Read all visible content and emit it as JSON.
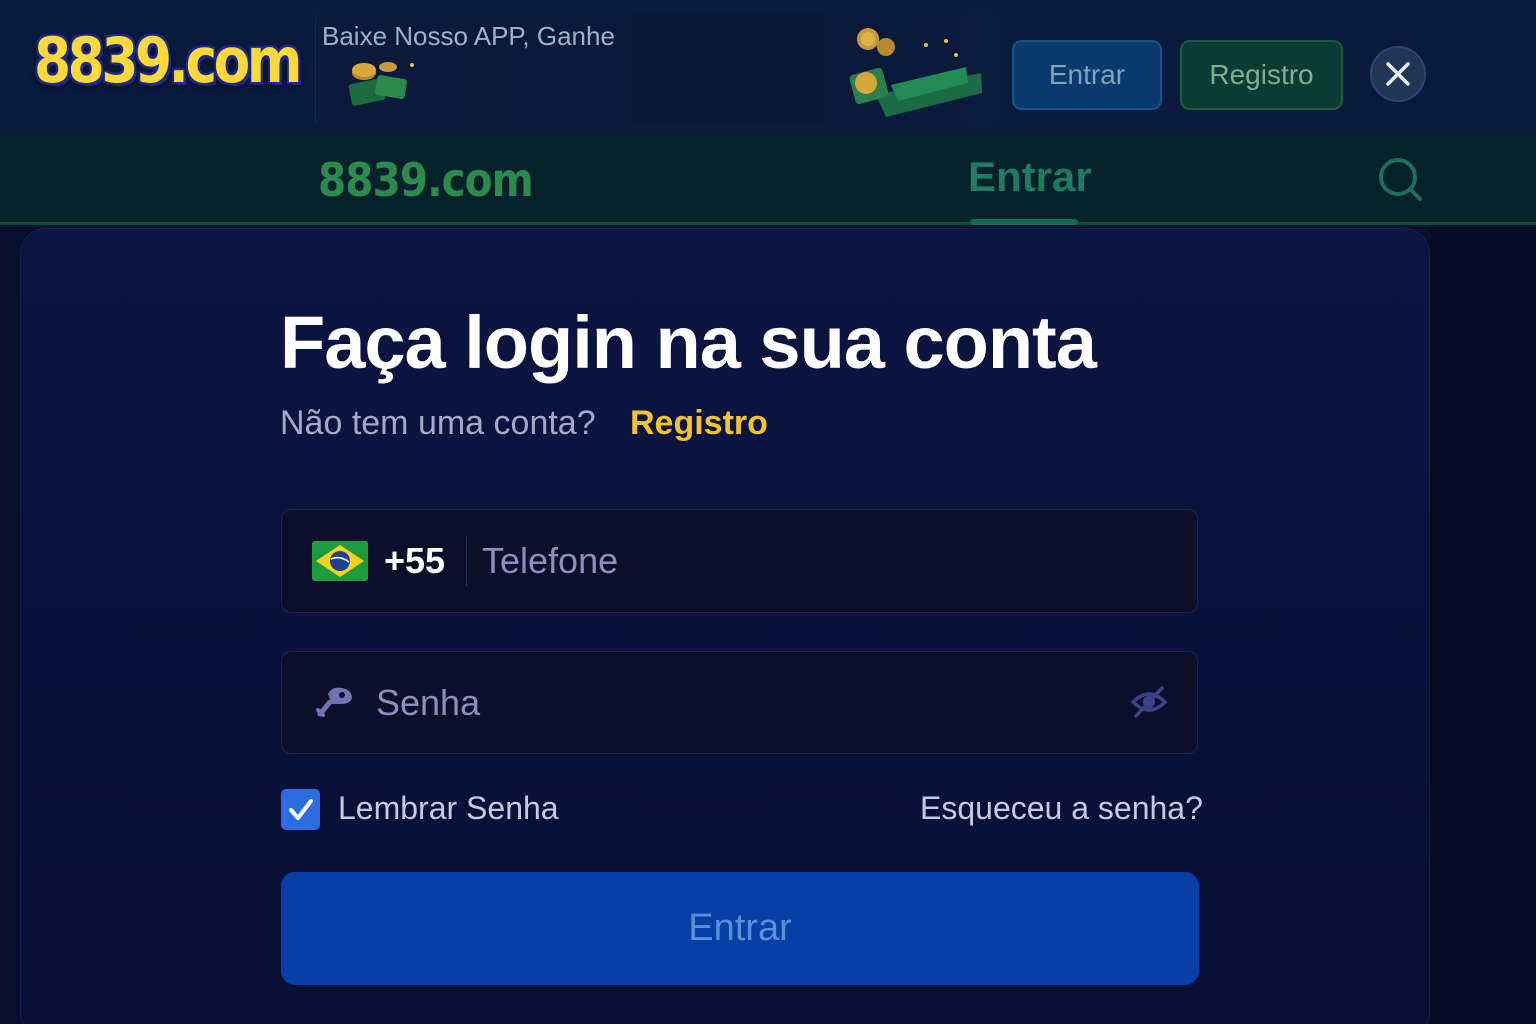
{
  "banner": {
    "logo_text": "8839.com",
    "promo_text": "Baixe Nosso APP, Ganhe",
    "login_label": "Entrar",
    "register_label": "Registro"
  },
  "nav": {
    "logo_text": "8839.com",
    "active_tab": "Entrar"
  },
  "login": {
    "title": "Faça login na sua conta",
    "no_account_text": "Não tem uma conta?",
    "register_link": "Registro",
    "country_code": "+55",
    "phone_placeholder": "Telefone",
    "password_placeholder": "Senha",
    "remember_label": "Lembrar Senha",
    "remember_checked": true,
    "forgot_link": "Esqueceu a senha?",
    "submit_label": "Entrar"
  },
  "icons": {
    "close": "close-icon",
    "search": "search-icon",
    "flag": "brazil-flag-icon",
    "key": "key-icon",
    "eye": "eye-off-icon",
    "check": "checkmark-icon"
  },
  "colors": {
    "accent_blue": "#073fa6",
    "link_yellow": "#f2c42b",
    "logo_yellow": "#ffd93a",
    "nav_green": "#1f7a63"
  }
}
